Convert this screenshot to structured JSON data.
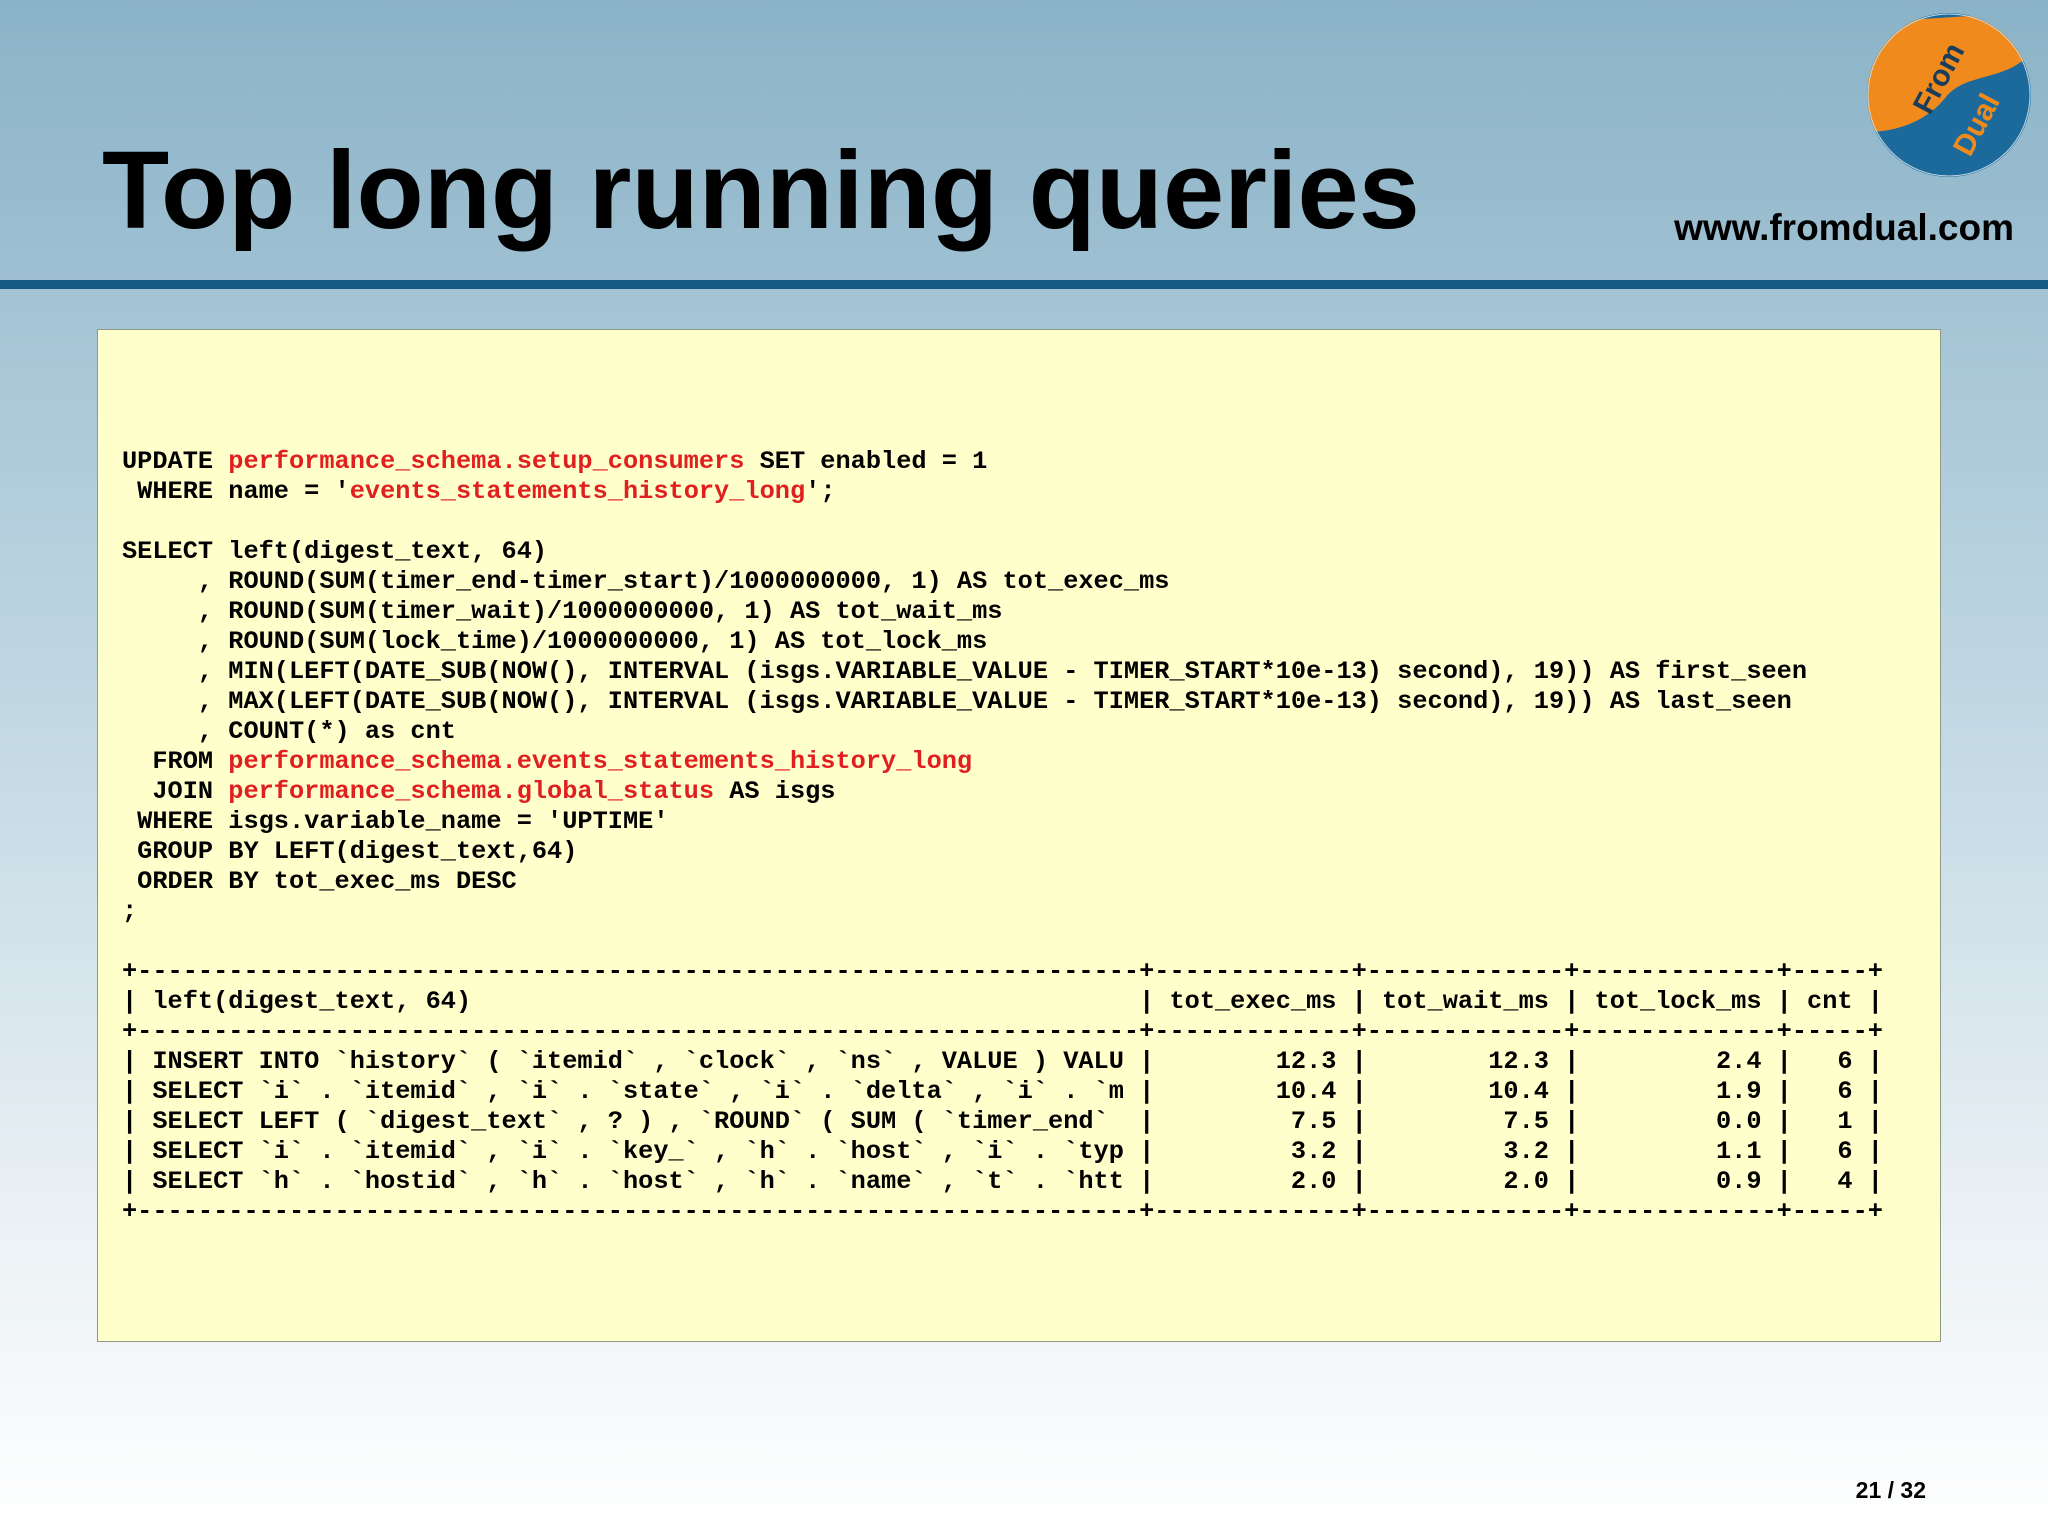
{
  "slide": {
    "title": "Top long running queries",
    "site_url": "www.fromdual.com",
    "page_number": "21 / 32",
    "logo": {
      "icon": "fromdual-logo-icon",
      "text_top": "From",
      "text_bottom": "Dual",
      "colors": {
        "orange": "#f08a1c",
        "blue": "#1c6a9c"
      }
    }
  },
  "colors": {
    "title_bar_divider": "#155a86",
    "code_background": "#ffffcc",
    "code_highlight": "#e02020"
  },
  "code_lines": [
    [
      {
        "t": "UPDATE "
      },
      {
        "t": "performance_schema.setup_consumers",
        "hl": true
      },
      {
        "t": " SET enabled = 1"
      }
    ],
    [
      {
        "t": " WHERE name = '"
      },
      {
        "t": "events_statements_history_long",
        "hl": true
      },
      {
        "t": "';"
      }
    ],
    [
      {
        "t": ""
      }
    ],
    [
      {
        "t": "SELECT left(digest_text, 64)"
      }
    ],
    [
      {
        "t": "     , ROUND(SUM(timer_end-timer_start)/1000000000, 1) AS tot_exec_ms"
      }
    ],
    [
      {
        "t": "     , ROUND(SUM(timer_wait)/1000000000, 1) AS tot_wait_ms"
      }
    ],
    [
      {
        "t": "     , ROUND(SUM(lock_time)/1000000000, 1) AS tot_lock_ms"
      }
    ],
    [
      {
        "t": "     , MIN(LEFT(DATE_SUB(NOW(), INTERVAL (isgs.VARIABLE_VALUE - TIMER_START*10e-13) second), 19)) AS first_seen"
      }
    ],
    [
      {
        "t": "     , MAX(LEFT(DATE_SUB(NOW(), INTERVAL (isgs.VARIABLE_VALUE - TIMER_START*10e-13) second), 19)) AS last_seen"
      }
    ],
    [
      {
        "t": "     , COUNT(*) as cnt"
      }
    ],
    [
      {
        "t": "  FROM "
      },
      {
        "t": "performance_schema.events_statements_history_long",
        "hl": true
      }
    ],
    [
      {
        "t": "  JOIN "
      },
      {
        "t": "performance_schema.global_status",
        "hl": true
      },
      {
        "t": " AS isgs"
      }
    ],
    [
      {
        "t": " WHERE isgs.variable_name = 'UPTIME'"
      }
    ],
    [
      {
        "t": " GROUP BY LEFT(digest_text,64)"
      }
    ],
    [
      {
        "t": " ORDER BY tot_exec_ms DESC"
      }
    ],
    [
      {
        "t": ";"
      }
    ],
    [
      {
        "t": ""
      }
    ],
    [
      {
        "t": "+------------------------------------------------------------------+-------------+-------------+-------------+-----+"
      }
    ],
    [
      {
        "t": "| left(digest_text, 64)                                            | tot_exec_ms | tot_wait_ms | tot_lock_ms | cnt |"
      }
    ],
    [
      {
        "t": "+------------------------------------------------------------------+-------------+-------------+-------------+-----+"
      }
    ],
    [
      {
        "t": "| INSERT INTO `history` ( `itemid` , `clock` , `ns` , VALUE ) VALU |        12.3 |        12.3 |         2.4 |   6 |"
      }
    ],
    [
      {
        "t": "| SELECT `i` . `itemid` , `i` . `state` , `i` . `delta` , `i` . `m |        10.4 |        10.4 |         1.9 |   6 |"
      }
    ],
    [
      {
        "t": "| SELECT LEFT ( `digest_text` , ? ) , `ROUND` ( SUM ( `timer_end`  |         7.5 |         7.5 |         0.0 |   1 |"
      }
    ],
    [
      {
        "t": "| SELECT `i` . `itemid` , `i` . `key_` , `h` . `host` , `i` . `typ |         3.2 |         3.2 |         1.1 |   6 |"
      }
    ],
    [
      {
        "t": "| SELECT `h` . `hostid` , `h` . `host` , `h` . `name` , `t` . `htt |         2.0 |         2.0 |         0.9 |   4 |"
      }
    ],
    [
      {
        "t": "+------------------------------------------------------------------+-------------+-------------+-------------+-----+"
      }
    ]
  ]
}
